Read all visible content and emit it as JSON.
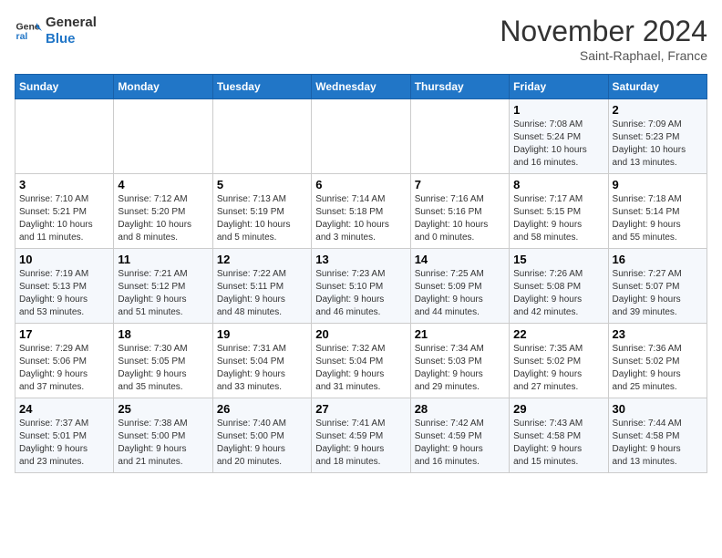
{
  "header": {
    "logo_line1": "General",
    "logo_line2": "Blue",
    "month": "November 2024",
    "location": "Saint-Raphael, France"
  },
  "days_of_week": [
    "Sunday",
    "Monday",
    "Tuesday",
    "Wednesday",
    "Thursday",
    "Friday",
    "Saturday"
  ],
  "weeks": [
    [
      {
        "day": "",
        "info": ""
      },
      {
        "day": "",
        "info": ""
      },
      {
        "day": "",
        "info": ""
      },
      {
        "day": "",
        "info": ""
      },
      {
        "day": "",
        "info": ""
      },
      {
        "day": "1",
        "info": "Sunrise: 7:08 AM\nSunset: 5:24 PM\nDaylight: 10 hours\nand 16 minutes."
      },
      {
        "day": "2",
        "info": "Sunrise: 7:09 AM\nSunset: 5:23 PM\nDaylight: 10 hours\nand 13 minutes."
      }
    ],
    [
      {
        "day": "3",
        "info": "Sunrise: 7:10 AM\nSunset: 5:21 PM\nDaylight: 10 hours\nand 11 minutes."
      },
      {
        "day": "4",
        "info": "Sunrise: 7:12 AM\nSunset: 5:20 PM\nDaylight: 10 hours\nand 8 minutes."
      },
      {
        "day": "5",
        "info": "Sunrise: 7:13 AM\nSunset: 5:19 PM\nDaylight: 10 hours\nand 5 minutes."
      },
      {
        "day": "6",
        "info": "Sunrise: 7:14 AM\nSunset: 5:18 PM\nDaylight: 10 hours\nand 3 minutes."
      },
      {
        "day": "7",
        "info": "Sunrise: 7:16 AM\nSunset: 5:16 PM\nDaylight: 10 hours\nand 0 minutes."
      },
      {
        "day": "8",
        "info": "Sunrise: 7:17 AM\nSunset: 5:15 PM\nDaylight: 9 hours\nand 58 minutes."
      },
      {
        "day": "9",
        "info": "Sunrise: 7:18 AM\nSunset: 5:14 PM\nDaylight: 9 hours\nand 55 minutes."
      }
    ],
    [
      {
        "day": "10",
        "info": "Sunrise: 7:19 AM\nSunset: 5:13 PM\nDaylight: 9 hours\nand 53 minutes."
      },
      {
        "day": "11",
        "info": "Sunrise: 7:21 AM\nSunset: 5:12 PM\nDaylight: 9 hours\nand 51 minutes."
      },
      {
        "day": "12",
        "info": "Sunrise: 7:22 AM\nSunset: 5:11 PM\nDaylight: 9 hours\nand 48 minutes."
      },
      {
        "day": "13",
        "info": "Sunrise: 7:23 AM\nSunset: 5:10 PM\nDaylight: 9 hours\nand 46 minutes."
      },
      {
        "day": "14",
        "info": "Sunrise: 7:25 AM\nSunset: 5:09 PM\nDaylight: 9 hours\nand 44 minutes."
      },
      {
        "day": "15",
        "info": "Sunrise: 7:26 AM\nSunset: 5:08 PM\nDaylight: 9 hours\nand 42 minutes."
      },
      {
        "day": "16",
        "info": "Sunrise: 7:27 AM\nSunset: 5:07 PM\nDaylight: 9 hours\nand 39 minutes."
      }
    ],
    [
      {
        "day": "17",
        "info": "Sunrise: 7:29 AM\nSunset: 5:06 PM\nDaylight: 9 hours\nand 37 minutes."
      },
      {
        "day": "18",
        "info": "Sunrise: 7:30 AM\nSunset: 5:05 PM\nDaylight: 9 hours\nand 35 minutes."
      },
      {
        "day": "19",
        "info": "Sunrise: 7:31 AM\nSunset: 5:04 PM\nDaylight: 9 hours\nand 33 minutes."
      },
      {
        "day": "20",
        "info": "Sunrise: 7:32 AM\nSunset: 5:04 PM\nDaylight: 9 hours\nand 31 minutes."
      },
      {
        "day": "21",
        "info": "Sunrise: 7:34 AM\nSunset: 5:03 PM\nDaylight: 9 hours\nand 29 minutes."
      },
      {
        "day": "22",
        "info": "Sunrise: 7:35 AM\nSunset: 5:02 PM\nDaylight: 9 hours\nand 27 minutes."
      },
      {
        "day": "23",
        "info": "Sunrise: 7:36 AM\nSunset: 5:02 PM\nDaylight: 9 hours\nand 25 minutes."
      }
    ],
    [
      {
        "day": "24",
        "info": "Sunrise: 7:37 AM\nSunset: 5:01 PM\nDaylight: 9 hours\nand 23 minutes."
      },
      {
        "day": "25",
        "info": "Sunrise: 7:38 AM\nSunset: 5:00 PM\nDaylight: 9 hours\nand 21 minutes."
      },
      {
        "day": "26",
        "info": "Sunrise: 7:40 AM\nSunset: 5:00 PM\nDaylight: 9 hours\nand 20 minutes."
      },
      {
        "day": "27",
        "info": "Sunrise: 7:41 AM\nSunset: 4:59 PM\nDaylight: 9 hours\nand 18 minutes."
      },
      {
        "day": "28",
        "info": "Sunrise: 7:42 AM\nSunset: 4:59 PM\nDaylight: 9 hours\nand 16 minutes."
      },
      {
        "day": "29",
        "info": "Sunrise: 7:43 AM\nSunset: 4:58 PM\nDaylight: 9 hours\nand 15 minutes."
      },
      {
        "day": "30",
        "info": "Sunrise: 7:44 AM\nSunset: 4:58 PM\nDaylight: 9 hours\nand 13 minutes."
      }
    ]
  ]
}
